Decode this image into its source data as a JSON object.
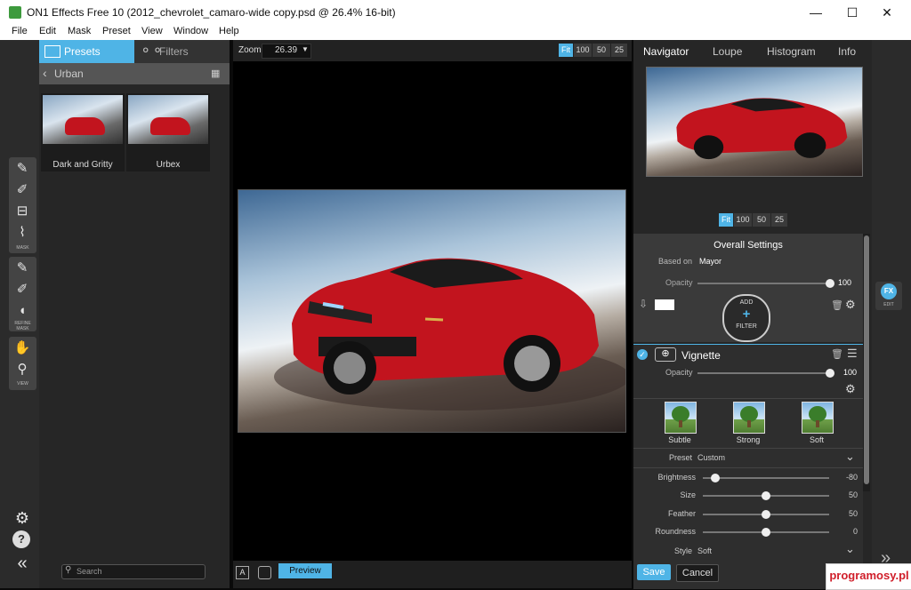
{
  "window": {
    "title": "ON1 Effects Free 10 (2012_chevrolet_camaro-wide copy.psd @ 26.4% 16-bit)",
    "minimize": "—",
    "maximize": "☐",
    "close": "✕"
  },
  "menu": [
    "File",
    "Edit",
    "Mask",
    "Preset",
    "View",
    "Window",
    "Help"
  ],
  "toolstrip": {
    "mask_label": "MASK",
    "refine_label": "REFINE MASK",
    "view_label": "VIEW"
  },
  "browser": {
    "tabs": {
      "presets": "Presets",
      "filters": "Filters"
    },
    "category": "Urban",
    "presets": [
      {
        "label": "Dark and Gritty"
      },
      {
        "label": "Urbex"
      }
    ],
    "search_placeholder": "Search"
  },
  "center": {
    "zoom_label": "Zoom",
    "zoom_value": "26.39",
    "zoom_buttons": [
      "Fit",
      "100",
      "50",
      "25"
    ],
    "preview_label": "Preview"
  },
  "right": {
    "tabs": [
      "Navigator",
      "Loupe",
      "Histogram",
      "Info"
    ],
    "nav_zoom_buttons": [
      "Fit",
      "100",
      "50",
      "25"
    ],
    "overall": {
      "title": "Overall Settings",
      "based_on_label": "Based on",
      "based_on_value": "Mayor",
      "opacity_label": "Opacity",
      "opacity_value": "100",
      "add_filter_top": "ADD",
      "add_filter_bottom": "FILTER"
    },
    "vignette": {
      "title": "Vignette",
      "opacity_label": "Opacity",
      "opacity_value": "100",
      "presets": [
        "Subtle",
        "Strong",
        "Soft"
      ],
      "preset_label": "Preset",
      "preset_value": "Custom",
      "adjustments": [
        {
          "label": "Brightness",
          "value": "-80",
          "level": 0.1
        },
        {
          "label": "Size",
          "value": "50",
          "level": 0.5
        },
        {
          "label": "Feather",
          "value": "50",
          "level": 0.5
        },
        {
          "label": "Roundness",
          "value": "0",
          "level": 0.5
        }
      ],
      "style_label": "Style",
      "style_value": "Soft"
    },
    "save_label": "Save",
    "cancel_label": "Cancel"
  },
  "rightstrip": {
    "edit_label": "EDIT",
    "fx_label": "FX"
  },
  "watermark": "programosy.pl",
  "colors": {
    "accent": "#4fb4e6",
    "car_red": "#c2141e"
  }
}
